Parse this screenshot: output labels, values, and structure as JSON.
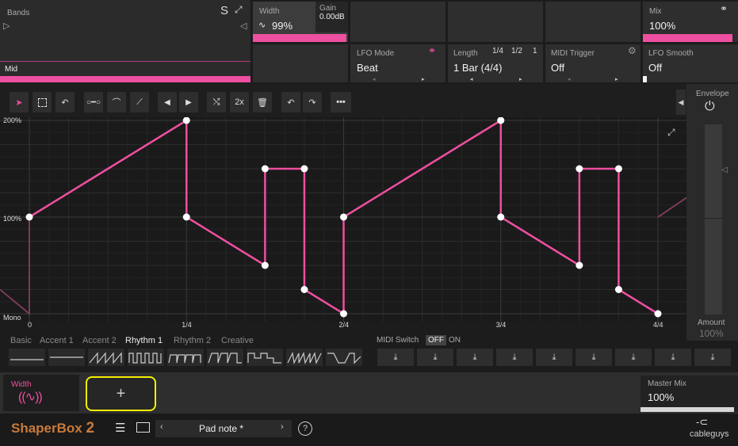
{
  "top": {
    "bands": {
      "label": "Bands",
      "s_btn": "S",
      "band_name": "Mid"
    },
    "width": {
      "label": "Width",
      "value": "99%"
    },
    "gain": {
      "label": "Gain",
      "value": "0.00dB"
    },
    "mix": {
      "label": "Mix",
      "value": "100%"
    },
    "lfo_mode": {
      "label": "LFO Mode",
      "value": "Beat"
    },
    "length": {
      "label": "Length",
      "value": "1 Bar (4/4)",
      "q1": "1/4",
      "q2": "1/2",
      "q3": "1"
    },
    "midi_trigger": {
      "label": "MIDI Trigger",
      "value": "Off"
    },
    "lfo_smooth": {
      "label": "LFO Smooth",
      "value": "Off"
    }
  },
  "toolbar": {
    "x2": "2x"
  },
  "envelope": {
    "label": "Envelope",
    "amount_label": "Amount",
    "amount_value": "100%"
  },
  "graph": {
    "y_labels": [
      "200%",
      "100%",
      "Mono"
    ],
    "x_labels": [
      "0",
      "1/4",
      "2/4",
      "3/4",
      "4/4"
    ],
    "points": [
      [
        0,
        100
      ],
      [
        0.25,
        200
      ],
      [
        0.25,
        100
      ],
      [
        0.375,
        50
      ],
      [
        0.375,
        150
      ],
      [
        0.4375,
        150
      ],
      [
        0.4375,
        25
      ],
      [
        0.5,
        0
      ],
      [
        0.5,
        100
      ],
      [
        0.75,
        200
      ],
      [
        0.75,
        100
      ],
      [
        0.875,
        50
      ],
      [
        0.875,
        150
      ],
      [
        0.9375,
        150
      ],
      [
        0.9375,
        25
      ],
      [
        1,
        0
      ]
    ]
  },
  "presets": {
    "tabs": [
      "Basic",
      "Accent 1",
      "Accent 2",
      "Rhythm 1",
      "Rhythm 2",
      "Creative"
    ],
    "active": "Rhythm 1",
    "midi_switch": {
      "label": "MIDI Switch",
      "off": "OFF",
      "on": "ON"
    }
  },
  "slot": {
    "width_label": "Width",
    "add": "+"
  },
  "master": {
    "label": "Master Mix",
    "value": "100%"
  },
  "footer": {
    "logo_a": "ShaperBox",
    "logo_b": "2",
    "preset_name": "Pad note *",
    "help": "?",
    "brand": "cableguys"
  },
  "colors": {
    "accent": "#ee4fa0",
    "highlight": "#ffff00"
  }
}
